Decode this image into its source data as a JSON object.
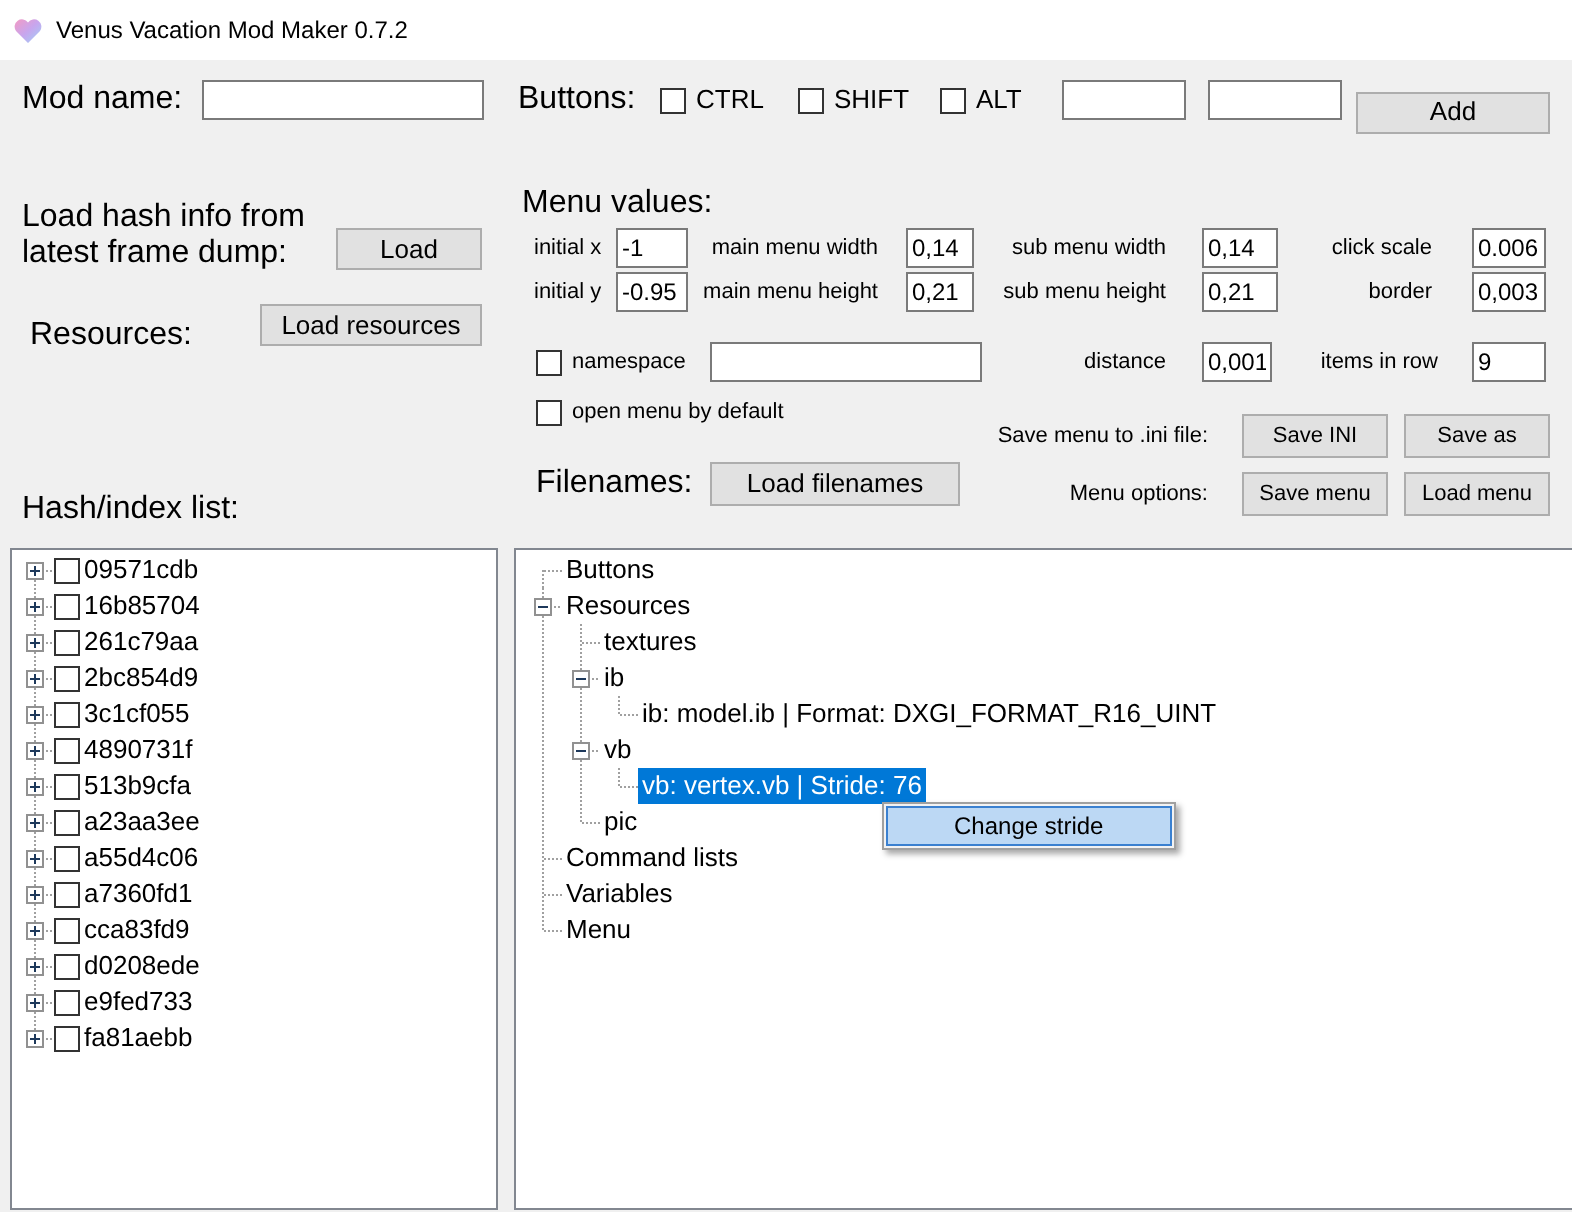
{
  "window": {
    "title": "Venus Vacation Mod Maker 0.7.2"
  },
  "mod_name": {
    "label": "Mod name:"
  },
  "buttons_row": {
    "label": "Buttons:",
    "modifiers": [
      {
        "label": "CTRL",
        "checked": false
      },
      {
        "label": "SHIFT",
        "checked": false
      },
      {
        "label": "ALT",
        "checked": false
      }
    ],
    "add_button": "Add"
  },
  "load_hash": {
    "label": "Load hash info from latest frame dump:",
    "button": "Load"
  },
  "resources": {
    "label": "Resources:",
    "button": "Load resources"
  },
  "menu_values": {
    "title": "Menu values:",
    "fields": [
      {
        "label": "initial x",
        "value": "-1"
      },
      {
        "label": "main menu width",
        "value": "0,14"
      },
      {
        "label": "sub menu width",
        "value": "0,14"
      },
      {
        "label": "click scale",
        "value": "0.006"
      },
      {
        "label": "initial y",
        "value": "-0.95"
      },
      {
        "label": "main menu height",
        "value": "0,21"
      },
      {
        "label": "sub menu height",
        "value": "0,21"
      },
      {
        "label": "border",
        "value": "0,003"
      }
    ],
    "namespace": {
      "label": "namespace",
      "checked": false
    },
    "distance": {
      "label": "distance",
      "value": "0,001"
    },
    "items_in_row": {
      "label": "items in row",
      "value": "9"
    },
    "open_menu_by_default": {
      "label": "open menu by default",
      "checked": false
    }
  },
  "save_ini": {
    "label": "Save menu to .ini file:",
    "buttons": [
      "Save INI",
      "Save as"
    ]
  },
  "filenames": {
    "label": "Filenames:",
    "button": "Load filenames"
  },
  "menu_options": {
    "label": "Menu options:",
    "buttons": [
      "Save menu",
      "Load menu"
    ]
  },
  "hash_list": {
    "label": "Hash/index list:",
    "items": [
      {
        "label": "09571cdb",
        "checked": false,
        "expanded": false
      },
      {
        "label": "16b85704",
        "checked": false,
        "expanded": false
      },
      {
        "label": "261c79aa",
        "checked": false,
        "expanded": false
      },
      {
        "label": "2bc854d9",
        "checked": false,
        "expanded": false
      },
      {
        "label": "3c1cf055",
        "checked": false,
        "expanded": false
      },
      {
        "label": "4890731f",
        "checked": false,
        "expanded": false
      },
      {
        "label": "513b9cfa",
        "checked": false,
        "expanded": false
      },
      {
        "label": "a23aa3ee",
        "checked": false,
        "expanded": false
      },
      {
        "label": "a55d4c06",
        "checked": false,
        "expanded": false
      },
      {
        "label": "a7360fd1",
        "checked": false,
        "expanded": false
      },
      {
        "label": "cca83fd9",
        "checked": false,
        "expanded": false
      },
      {
        "label": "d0208ede",
        "checked": false,
        "expanded": false
      },
      {
        "label": "e9fed733",
        "checked": false,
        "expanded": false
      },
      {
        "label": "fa81aebb",
        "checked": false,
        "expanded": false
      }
    ]
  },
  "menu_tree": {
    "items": [
      {
        "label": "Buttons",
        "selected": false
      },
      {
        "label": "Resources",
        "selected": false,
        "expanded": true,
        "children": [
          {
            "label": "textures",
            "selected": false
          },
          {
            "label": "ib",
            "selected": false,
            "expanded": true,
            "children": [
              {
                "label": "ib: model.ib | Format: DXGI_FORMAT_R16_UINT",
                "selected": false
              }
            ]
          },
          {
            "label": "vb",
            "selected": false,
            "expanded": true,
            "children": [
              {
                "label": "vb: vertex.vb | Stride: 76",
                "selected": true
              }
            ]
          },
          {
            "label": "pic",
            "selected": false
          }
        ]
      },
      {
        "label": "Command lists",
        "selected": false
      },
      {
        "label": "Variables",
        "selected": false
      },
      {
        "label": "Menu",
        "selected": false
      }
    ]
  },
  "context_menu": {
    "items": [
      {
        "label": "Change stride",
        "selected": true
      }
    ]
  }
}
